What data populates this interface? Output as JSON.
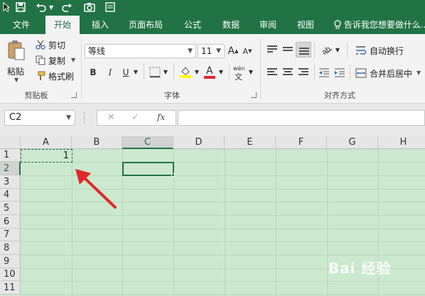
{
  "ribbon_tabs": [
    {
      "label": "文件"
    },
    {
      "label": "开始"
    },
    {
      "label": "插入"
    },
    {
      "label": "页面布局"
    },
    {
      "label": "公式"
    },
    {
      "label": "数据"
    },
    {
      "label": "审阅"
    },
    {
      "label": "视图"
    }
  ],
  "active_tab": "开始",
  "tell_me": "告诉我您想要做什么...",
  "clipboard": {
    "paste": "粘贴",
    "cut": "剪切",
    "copy": "复制",
    "format_painter": "格式刷",
    "group_label": "剪贴板"
  },
  "font": {
    "name": "等线",
    "size": "11",
    "bold": "B",
    "italic": "I",
    "underline": "U",
    "font_color_glyph": "A",
    "phonetic_glyph": "wén",
    "grow_glyph": "A",
    "shrink_glyph": "A",
    "group_label": "字体"
  },
  "alignment": {
    "wrap_text": "自动换行",
    "merge_center": "合并后居中",
    "group_label": "对齐方式"
  },
  "formula_bar": {
    "name_box": "C2",
    "cancel": "✕",
    "enter": "✓",
    "fx": "fx",
    "value": ""
  },
  "sheet": {
    "columns": [
      "A",
      "B",
      "C",
      "D",
      "E",
      "F",
      "G",
      "H"
    ],
    "rows": [
      "1",
      "2",
      "3",
      "4",
      "5",
      "6",
      "7",
      "8",
      "9",
      "10",
      "11"
    ],
    "selected_column": "C",
    "selected_row": "2",
    "cell_A1": "1"
  },
  "watermark": "Bai 经验",
  "colors": {
    "accent": "#217346",
    "grid_background": "#cce8cf",
    "arrow": "#e0282a"
  },
  "icons": [
    "save-icon",
    "undo-icon",
    "redo-icon",
    "paste-icon",
    "scissors-icon",
    "copy-icon",
    "format-painter-icon",
    "fill-color-icon",
    "font-color-icon",
    "lightbulb-icon",
    "arrow-annotation-icon"
  ]
}
